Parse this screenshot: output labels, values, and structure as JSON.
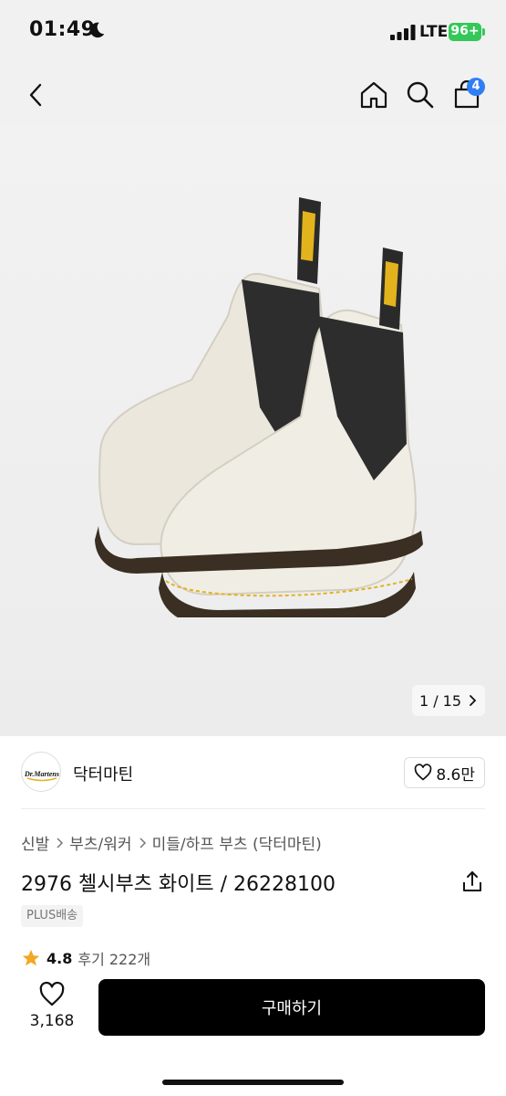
{
  "status_bar": {
    "time": "01:49",
    "network": "LTE",
    "battery": "96+"
  },
  "nav": {
    "cart_count": "4"
  },
  "gallery": {
    "pager_current": "1",
    "pager_total": "15",
    "pager_text": "1 / 15"
  },
  "brand": {
    "logo_text": "Dr. Martens",
    "name": "닥터마틴",
    "likes": "8.6만"
  },
  "breadcrumb": [
    "신발",
    "부츠/워커",
    "미들/하프 부츠 (닥터마틴)"
  ],
  "product": {
    "title": "2976 첼시부츠 화이트 / 26228100",
    "shipping_badge": "PLUS배송",
    "rating": "4.8",
    "reviews": "후기 222개"
  },
  "bottom": {
    "fav_count": "3,168",
    "buy_label": "구매하기"
  },
  "colors": {
    "accent_badge": "#2f7ef5",
    "battery": "#34c759",
    "star": "#f5a623",
    "buy_button": "#000000"
  }
}
